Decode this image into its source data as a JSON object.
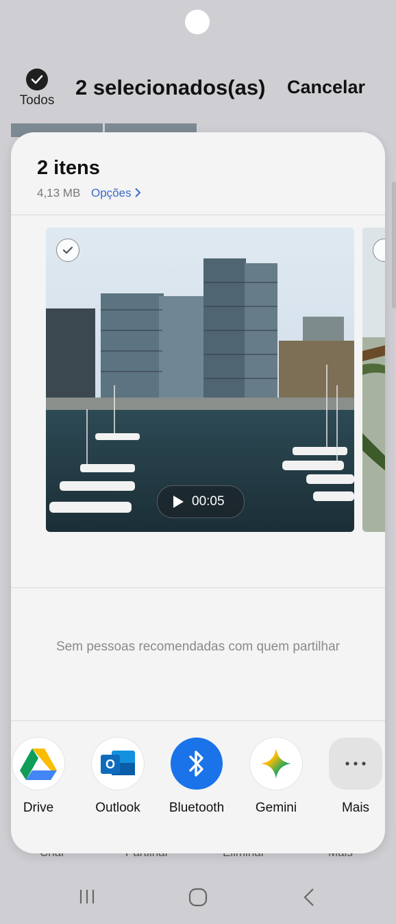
{
  "header": {
    "select_all_label": "Todos",
    "title": "2 selecionados(as)",
    "cancel_label": "Cancelar"
  },
  "behind_nav": [
    "Criar",
    "Partilhar",
    "Eliminar",
    "Mais"
  ],
  "sheet": {
    "title": "2 itens",
    "size": "4,13 MB",
    "options_label": "Opções",
    "video_duration": "00:05",
    "no_people_text": "Sem pessoas recomendadas com quem partilhar",
    "apps": [
      {
        "name": "Drive",
        "icon": "google-drive-icon"
      },
      {
        "name": "Outlook",
        "icon": "outlook-icon"
      },
      {
        "name": "Bluetooth",
        "icon": "bluetooth-icon"
      },
      {
        "name": "Gemini",
        "icon": "gemini-icon"
      },
      {
        "name": "Mais",
        "icon": "more-icon"
      }
    ]
  },
  "colors": {
    "accent": "#3a6ac7",
    "bluetooth": "#1a73e8"
  }
}
